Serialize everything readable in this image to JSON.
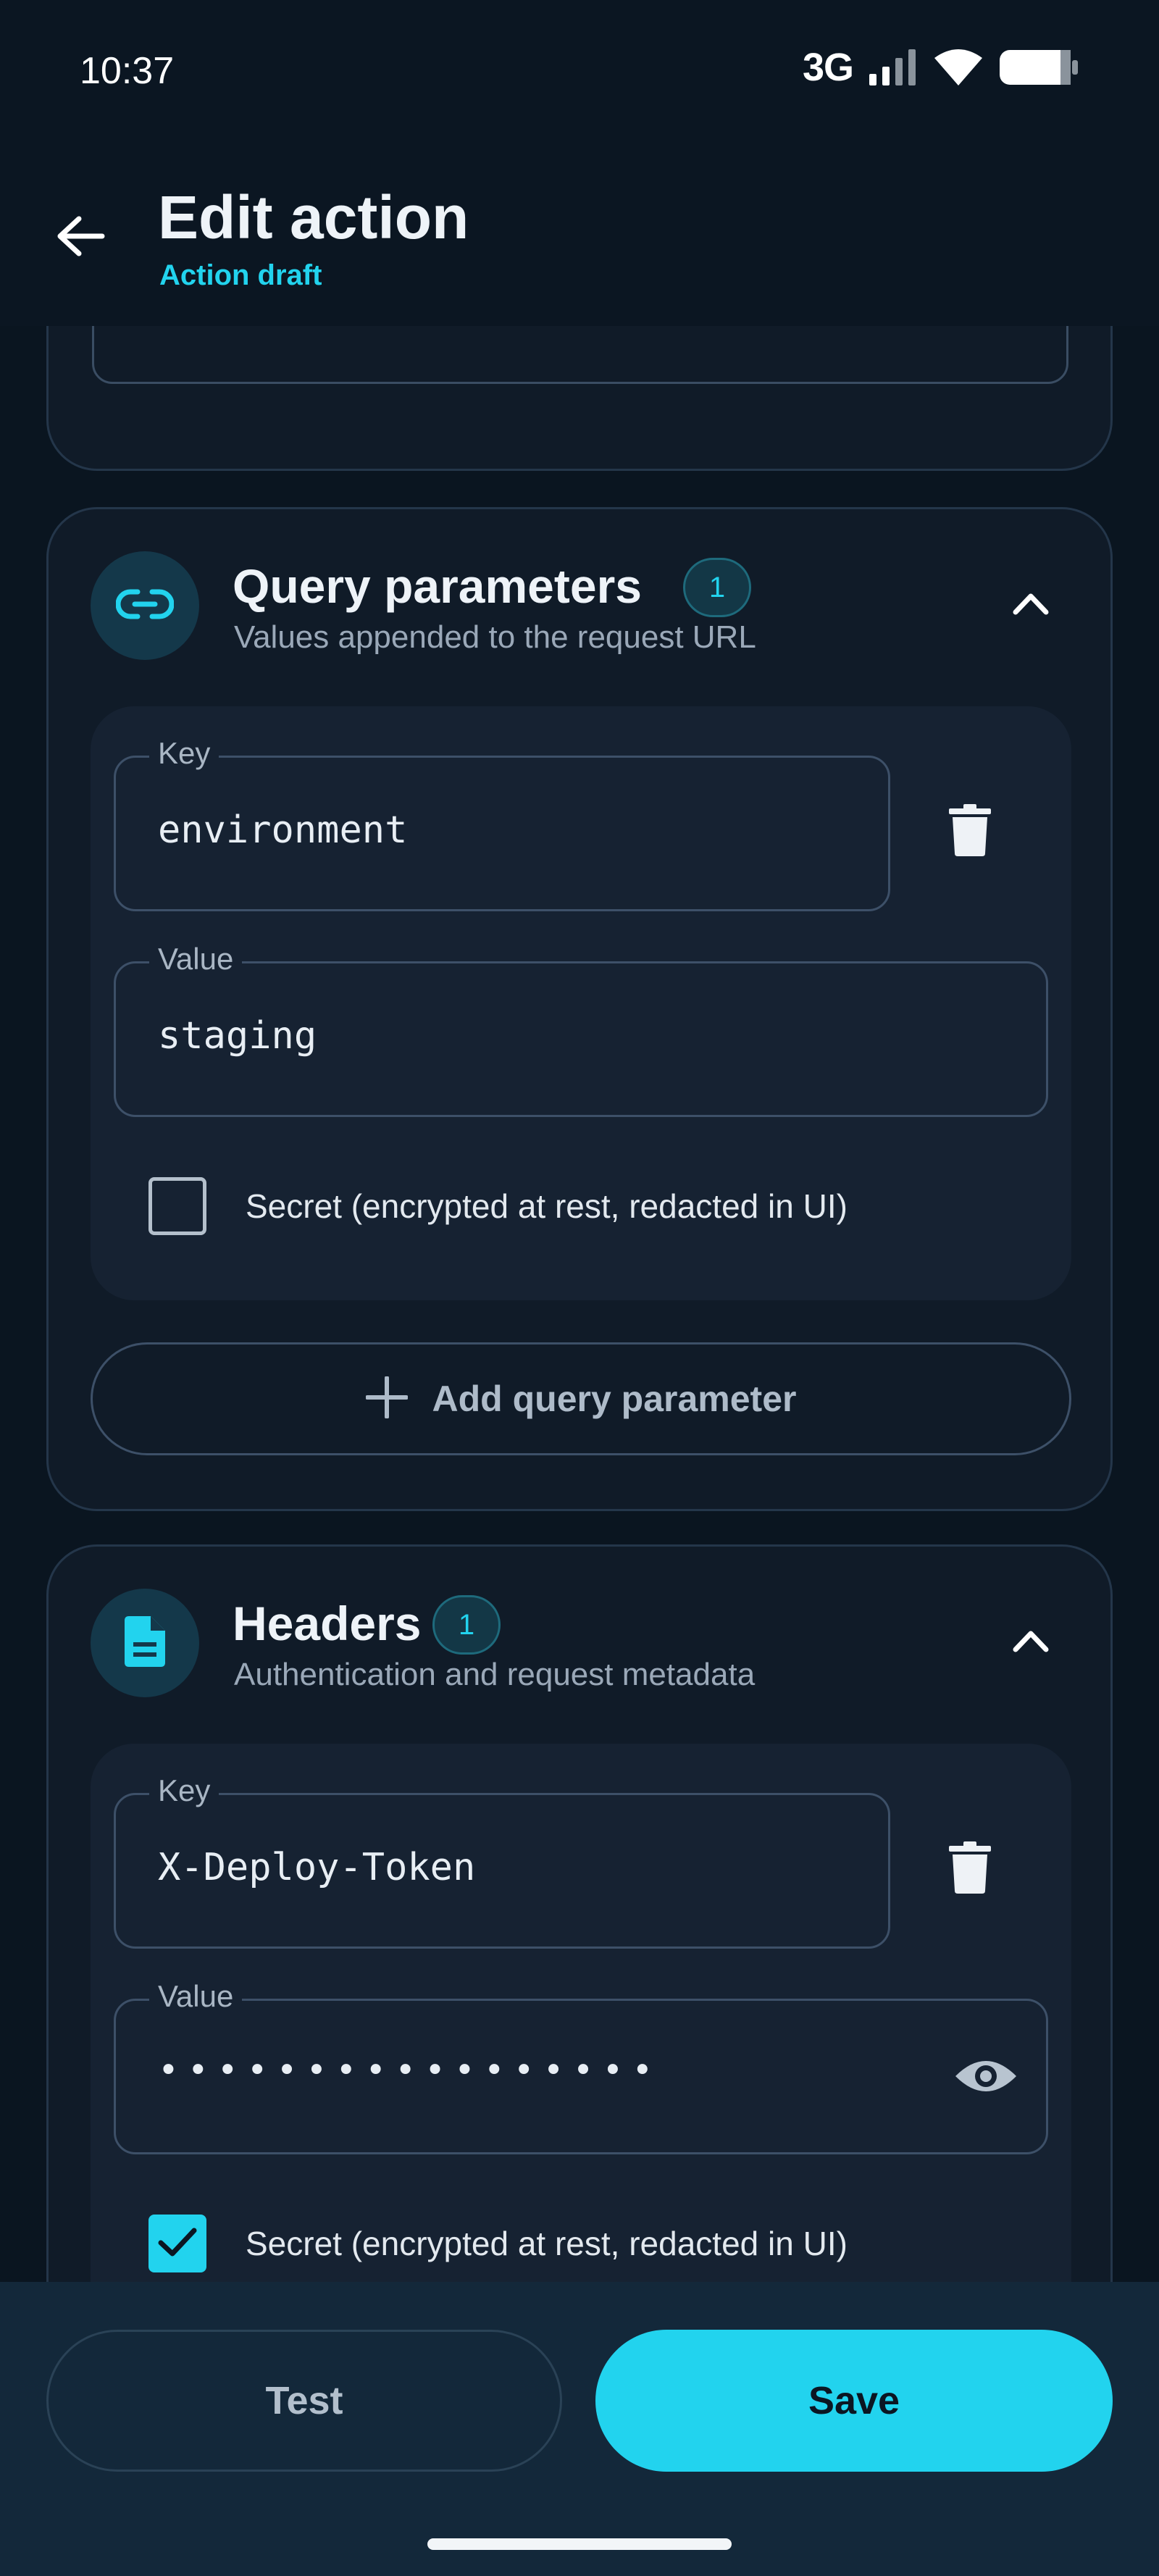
{
  "status_bar": {
    "time": "10:37",
    "network": "3G"
  },
  "app_bar": {
    "title": "Edit action",
    "subtitle": "Action draft"
  },
  "query_section": {
    "title": "Query parameters",
    "count": "1",
    "subtitle": "Values appended to the request URL",
    "entry": {
      "key_label": "Key",
      "key_value": "environment",
      "value_label": "Value",
      "value_value": "staging",
      "secret_label": "Secret (encrypted at rest, redacted in UI)",
      "secret_checked": false
    },
    "add_label": "Add query parameter"
  },
  "headers_section": {
    "title": "Headers",
    "count": "1",
    "subtitle": "Authentication and request metadata",
    "entry": {
      "key_label": "Key",
      "key_value": "X-Deploy-Token",
      "value_label": "Value",
      "value_value": "•••••••••••••••••",
      "secret_label": "Secret (encrypted at rest, redacted in UI)",
      "secret_checked": true
    }
  },
  "actions": {
    "test_label": "Test",
    "save_label": "Save"
  },
  "colors": {
    "accent": "#22d3ee",
    "background": "#0a1520",
    "card": "#101b28"
  },
  "icons": {
    "back": "arrow-left-icon",
    "query": "link-icon",
    "headers": "document-icon",
    "collapse": "chevron-up-icon",
    "delete": "trash-icon",
    "add": "plus-icon",
    "reveal": "eye-icon",
    "check": "check-icon"
  }
}
